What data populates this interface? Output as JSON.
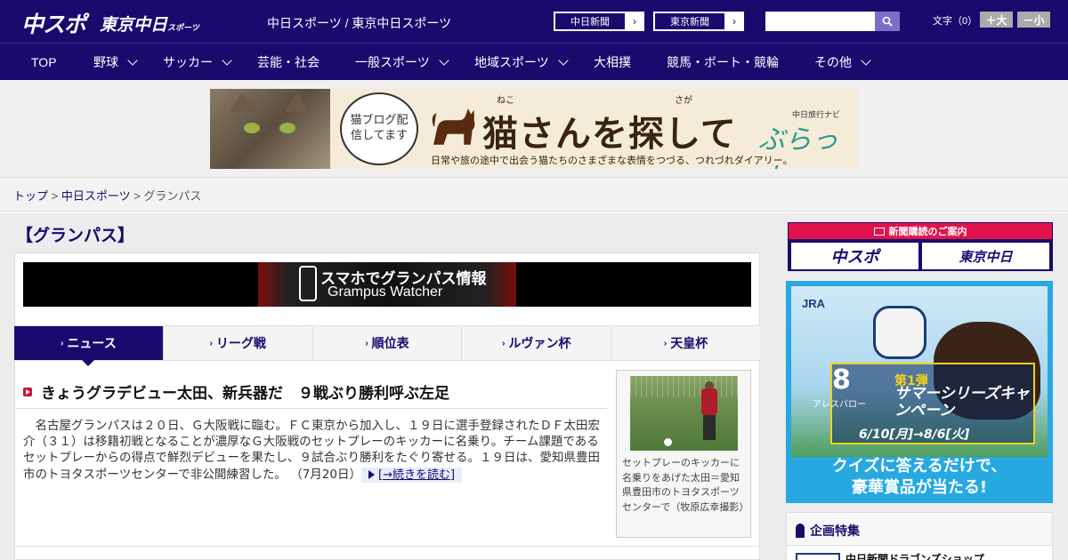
{
  "header": {
    "logo_main": "中スポ",
    "logo_tokyo": "東京中日",
    "logo_tokyo_small": "スポーツ",
    "site_title": "中日スポーツ / 東京中日スポーツ",
    "paper_links": [
      {
        "label": "中日新聞",
        "arrow": "›"
      },
      {
        "label": "東京新聞",
        "arrow": "›"
      }
    ],
    "search": {
      "placeholder": "",
      "button_icon": "search-icon"
    },
    "font_size": {
      "label": "文字（0）",
      "increase": "＋大",
      "decrease": "－小"
    }
  },
  "nav": {
    "items": [
      {
        "label": "TOP",
        "has_dropdown": false
      },
      {
        "label": "野球",
        "has_dropdown": true
      },
      {
        "label": "サッカー",
        "has_dropdown": true
      },
      {
        "label": "芸能・社会",
        "has_dropdown": false
      },
      {
        "label": "一般スポーツ",
        "has_dropdown": true
      },
      {
        "label": "地域スポーツ",
        "has_dropdown": true
      },
      {
        "label": "大相撲",
        "has_dropdown": false
      },
      {
        "label": "競馬・ボート・競輪",
        "has_dropdown": false
      },
      {
        "label": "その他",
        "has_dropdown": true
      }
    ]
  },
  "ad_banner": {
    "bubble_text": "猫ブログ配信してます",
    "title": "猫さんを探して",
    "ruby_neko": "ねこ",
    "ruby_saga": "さが",
    "subtitle": "日常や旅の途中で出会う猫たちのさまざまな表情をつづる、つれづれダイアリー。",
    "brand_small": "中日旅行ナビ",
    "brand": "ぶらっ人"
  },
  "breadcrumb": {
    "items": [
      "トップ",
      "中日スポーツ"
    ],
    "separator": " > ",
    "current": "グランパス"
  },
  "page_title": "【グランパス】",
  "grampus_banner": {
    "line1": "スマホでグランパス情報",
    "line2": "Grampus Watcher"
  },
  "tabs": [
    {
      "label": "ニュース",
      "active": true
    },
    {
      "label": "リーグ戦",
      "active": false
    },
    {
      "label": "順位表",
      "active": false
    },
    {
      "label": "ルヴァン杯",
      "active": false
    },
    {
      "label": "天皇杯",
      "active": false
    }
  ],
  "tab_caret": "›",
  "article": {
    "title": "きょうグラデビュー太田、新兵器だ　９戦ぶり勝利呼ぶ左足",
    "body": "名古屋グランパスは２０日、Ｇ大阪戦に臨む。ＦＣ東京から加入し、１９日に選手登録されたＤＦ太田宏介（３１）は移籍初戦となることが濃厚なＧ大阪戦のセットプレーのキッカーに名乗り。チーム課題であるセットプレーからの得点で鮮烈デビューを果たし、９試合ぶり勝利をたぐり寄せる。１９日は、愛知県豊田市のトヨタスポーツセンターで非公開練習した。",
    "date": "（7月20日）",
    "read_more": "[→続きを読む]",
    "photo_caption": "セットプレーのキッカーに名乗りをあげた太田＝愛知県豊田市のトヨタスポーツセンターで（牧原広幸撮影）"
  },
  "subscription": {
    "header": "新聞購読のご案内",
    "logo1": "中スポ",
    "logo2": "東京中日"
  },
  "jra_ad": {
    "logo": "JRA",
    "horse_number": "8",
    "horse_name": "アレスバロー",
    "campaign_num": "第1弾",
    "campaign_title": "サマーシリーズキャンペーン",
    "campaign_dates": "6/10[月]→8/6[火]",
    "quiz_line1": "クイズに答えるだけで、",
    "quiz_line2": "豪華賞品が当たる!"
  },
  "feature": {
    "header": "企画特集",
    "item": "中日新聞ドラゴンズショップ"
  },
  "colors": {
    "brand_navy": "#1a0a6e",
    "accent_red": "#e0134c",
    "jra_blue": "#27a8e0"
  }
}
